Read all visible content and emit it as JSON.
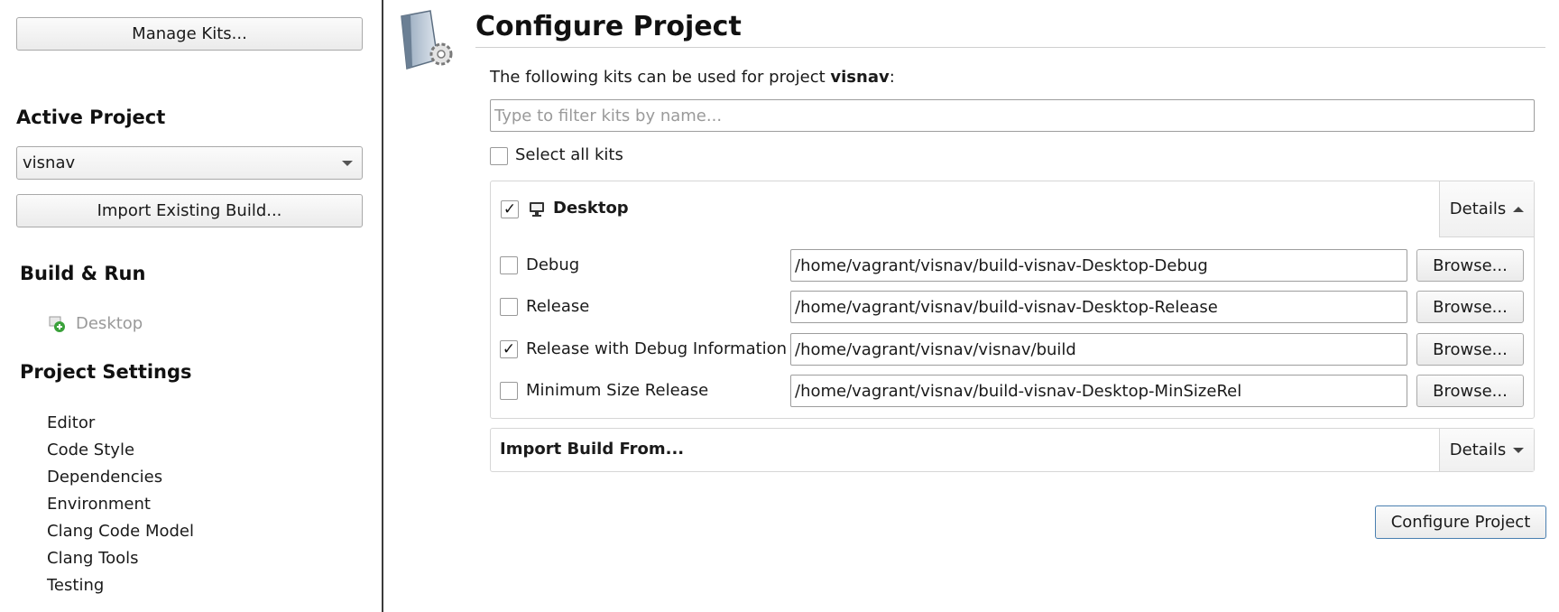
{
  "sidebar": {
    "manage_kits_label": "Manage Kits...",
    "active_project_heading": "Active Project",
    "active_project_value": "visnav",
    "import_existing_label": "Import Existing Build...",
    "build_run_heading": "Build & Run",
    "build_run_target": "Desktop",
    "project_settings_heading": "Project Settings",
    "settings_items": [
      "Editor",
      "Code Style",
      "Dependencies",
      "Environment",
      "Clang Code Model",
      "Clang Tools",
      "Testing"
    ]
  },
  "main": {
    "title": "Configure Project",
    "intro_prefix": "The following kits can be used for project ",
    "project_name": "visnav",
    "intro_suffix": ":",
    "filter_placeholder": "Type to filter kits by name...",
    "select_all_label": "Select all kits",
    "kit": {
      "name": "Desktop",
      "checked": true,
      "details_label": "Details",
      "builds": [
        {
          "label": "Debug",
          "checked": false,
          "path": "/home/vagrant/visnav/build-visnav-Desktop-Debug",
          "browse": "Browse..."
        },
        {
          "label": "Release",
          "checked": false,
          "path": "/home/vagrant/visnav/build-visnav-Desktop-Release",
          "browse": "Browse..."
        },
        {
          "label": "Release with Debug Information",
          "checked": true,
          "path": "/home/vagrant/visnav/visnav/build",
          "browse": "Browse..."
        },
        {
          "label": "Minimum Size Release",
          "checked": false,
          "path": "/home/vagrant/visnav/build-visnav-Desktop-MinSizeRel",
          "browse": "Browse..."
        }
      ]
    },
    "import_build": {
      "label": "Import Build From...",
      "details_label": "Details"
    },
    "configure_button": "Configure Project",
    "check_mark": "✓"
  },
  "colors": {
    "divider": "#3b3b3b",
    "accent_border": "#4a7fb0"
  }
}
